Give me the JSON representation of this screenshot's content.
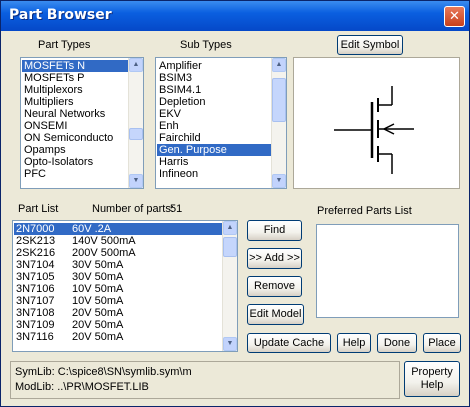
{
  "window": {
    "title": "Part Browser",
    "close_glyph": "✕"
  },
  "labels": {
    "part_types": "Part Types",
    "sub_types": "Sub Types",
    "part_list": "Part List",
    "number_of_parts": "Number of parts:",
    "number_of_parts_value": "51",
    "preferred_parts": "Preferred Parts List"
  },
  "part_types": [
    {
      "label": "MOSFETs N",
      "selected": true
    },
    {
      "label": "MOSFETs P"
    },
    {
      "label": "Multiplexors"
    },
    {
      "label": "Multipliers"
    },
    {
      "label": "Neural Networks"
    },
    {
      "label": "ONSEMI"
    },
    {
      "label": "ON Semiconducto"
    },
    {
      "label": "Opamps"
    },
    {
      "label": "Opto-Isolators"
    },
    {
      "label": "PFC"
    }
  ],
  "sub_types": [
    {
      "label": "Amplifier"
    },
    {
      "label": "BSIM3"
    },
    {
      "label": "BSIM4.1"
    },
    {
      "label": "Depletion"
    },
    {
      "label": "EKV"
    },
    {
      "label": "Enh"
    },
    {
      "label": "Fairchild"
    },
    {
      "label": "Gen. Purpose",
      "selected": true
    },
    {
      "label": "Harris"
    },
    {
      "label": "Infineon"
    }
  ],
  "parts": [
    {
      "name": "2N7000",
      "desc": "60V .2A",
      "selected": true
    },
    {
      "name": "2SK213",
      "desc": "140V 500mA"
    },
    {
      "name": "2SK216",
      "desc": "200V 500mA"
    },
    {
      "name": "3N7104",
      "desc": "30V 50mA"
    },
    {
      "name": "3N7105",
      "desc": "30V 50mA"
    },
    {
      "name": "3N7106",
      "desc": "10V 50mA"
    },
    {
      "name": "3N7107",
      "desc": "10V 50mA"
    },
    {
      "name": "3N7108",
      "desc": "20V 50mA"
    },
    {
      "name": "3N7109",
      "desc": "20V 50mA"
    },
    {
      "name": "3N7116",
      "desc": "20V 50mA"
    }
  ],
  "buttons": {
    "edit_symbol": "Edit Symbol",
    "find": "Find",
    "add": ">> Add >>",
    "remove": "Remove",
    "edit_model": "Edit Model",
    "update_cache": "Update  Cache",
    "help": "Help",
    "done": "Done",
    "place": "Place",
    "property_help_1": "Property",
    "property_help_2": "Help"
  },
  "status": {
    "symlib": "SymLib:  C:\\spice8\\SN\\symlib.sym\\m",
    "modlib": "ModLib:  ..\\PR\\MOSFET.LIB"
  },
  "scroll_glyphs": {
    "up": "▲",
    "down": "▼"
  },
  "colors": {
    "selection": "#316ac5",
    "titlebar": "#0548c8",
    "dialog": "#ece9d8"
  }
}
